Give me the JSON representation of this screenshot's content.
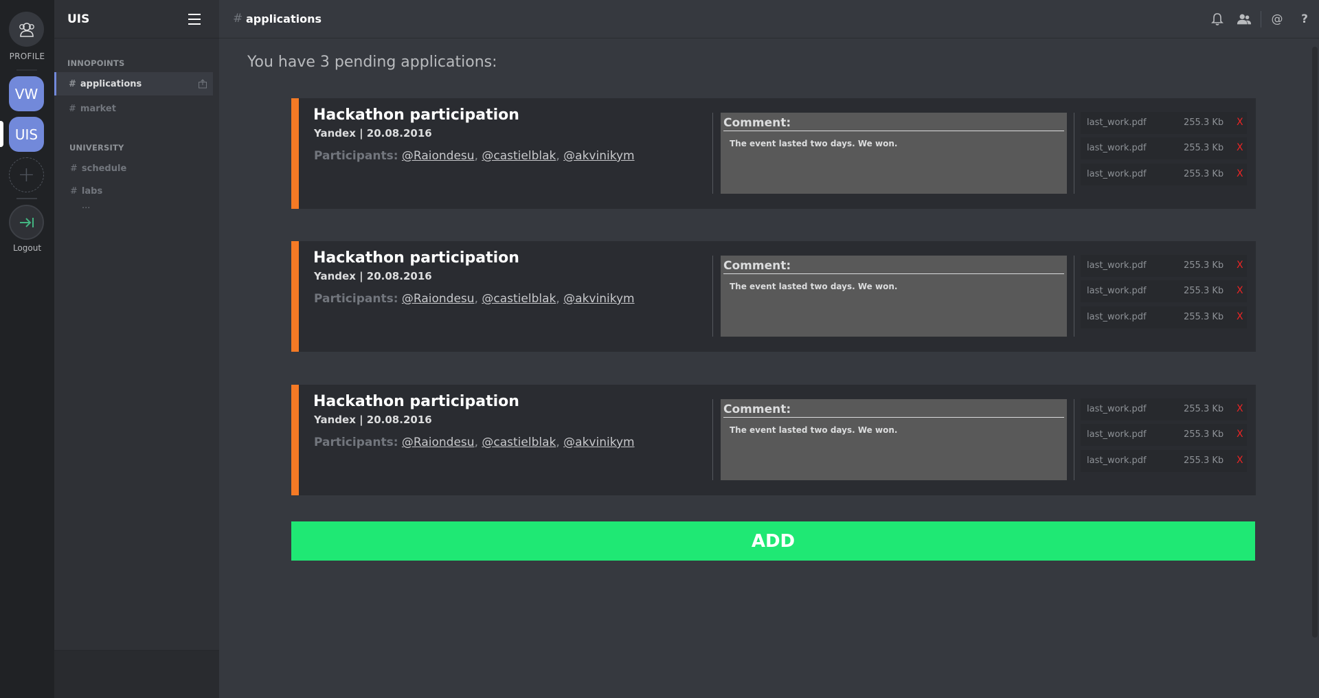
{
  "rail": {
    "profile_label": "PROFILE",
    "servers": [
      {
        "abbr": "VW"
      },
      {
        "abbr": "UIS"
      }
    ],
    "add_symbol": "+",
    "logout_label": "Logout"
  },
  "sidebar": {
    "server_name": "UIS",
    "categories": [
      {
        "name": "INNOPOINTS",
        "channels": [
          {
            "label": "applications",
            "active": true
          },
          {
            "label": "market",
            "active": false
          }
        ]
      },
      {
        "name": "UNIVERSITY",
        "channels": [
          {
            "label": "schedule",
            "active": false
          },
          {
            "label": "labs",
            "active": false
          }
        ],
        "more": "..."
      }
    ],
    "hash": "#"
  },
  "topbar": {
    "hash": "#",
    "channel_title": "applications",
    "icons": [
      "bell-icon",
      "people-icon",
      "at-icon",
      "help-icon"
    ],
    "at_symbol": "@",
    "help_symbol": "?"
  },
  "main": {
    "pending_text": "You have 3 pending applications:",
    "applications": [
      {
        "title": "Hackathon participation",
        "subtitle": "Yandex | 20.08.2016",
        "participants_label": "Participants:",
        "participants": [
          "@Raiondesu",
          "@castielblak",
          "@akvinikym"
        ],
        "comment_label": "Comment:",
        "comment": "The event lasted two days. We won.",
        "files": [
          {
            "name": "last_work.pdf",
            "size": "255.3 Kb",
            "delete": "X"
          },
          {
            "name": "last_work.pdf",
            "size": "255.3 Kb",
            "delete": "X"
          },
          {
            "name": "last_work.pdf",
            "size": "255.3 Kb",
            "delete": "X"
          }
        ]
      },
      {
        "title": "Hackathon participation",
        "subtitle": "Yandex | 20.08.2016",
        "participants_label": "Participants:",
        "participants": [
          "@Raiondesu",
          "@castielblak",
          "@akvinikym"
        ],
        "comment_label": "Comment:",
        "comment": "The event lasted two days. We won.",
        "files": [
          {
            "name": "last_work.pdf",
            "size": "255.3 Kb",
            "delete": "X"
          },
          {
            "name": "last_work.pdf",
            "size": "255.3 Kb",
            "delete": "X"
          },
          {
            "name": "last_work.pdf",
            "size": "255.3 Kb",
            "delete": "X"
          }
        ]
      },
      {
        "title": "Hackathon participation",
        "subtitle": "Yandex | 20.08.2016",
        "participants_label": "Participants:",
        "participants": [
          "@Raiondesu",
          "@castielblak",
          "@akvinikym"
        ],
        "comment_label": "Comment:",
        "comment": "The event lasted two days. We won.",
        "files": [
          {
            "name": "last_work.pdf",
            "size": "255.3 Kb",
            "delete": "X"
          },
          {
            "name": "last_work.pdf",
            "size": "255.3 Kb",
            "delete": "X"
          },
          {
            "name": "last_work.pdf",
            "size": "255.3 Kb",
            "delete": "X"
          }
        ]
      }
    ],
    "add_label": "ADD"
  },
  "colors": {
    "accent_stripe": "#f57a25",
    "add_button": "#1fe874",
    "server_blue": "#7289da",
    "delete_red": "#ed2424"
  }
}
